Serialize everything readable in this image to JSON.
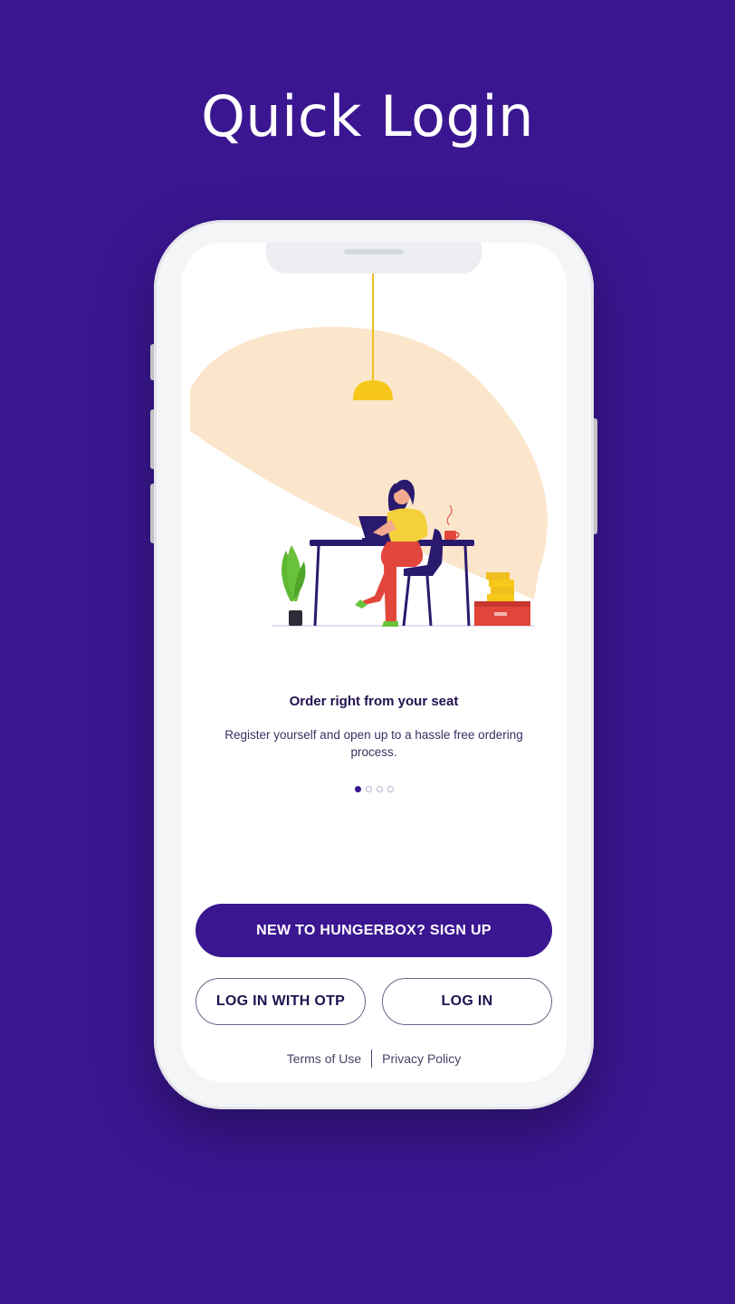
{
  "promo": {
    "title": "Quick Login"
  },
  "onboarding": {
    "slide_title": "Order right from your seat",
    "slide_description": "Register yourself and open up to a hassle free ordering process.",
    "page_count": 4,
    "active_page": 1
  },
  "actions": {
    "signup_label": "NEW TO HUNGERBOX? SIGN UP",
    "otp_label": "LOG IN WITH OTP",
    "login_label": "LOG IN"
  },
  "footer": {
    "terms_label": "Terms of Use",
    "privacy_label": "Privacy Policy"
  },
  "colors": {
    "background": "#3b1691",
    "accent": "#3b1691",
    "light_cone": "#fbe6cc",
    "lamp": "#f7c81a",
    "shirt": "#f4d13a",
    "pants": "#e2453a",
    "plant": "#6ac23b"
  }
}
